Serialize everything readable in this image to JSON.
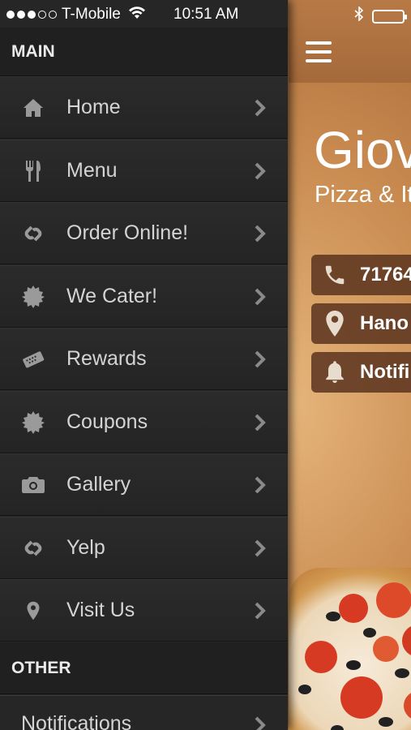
{
  "status_bar": {
    "carrier": "T-Mobile",
    "time": "10:51 AM"
  },
  "drawer": {
    "main_section": "MAIN",
    "main_items": [
      {
        "label": "Home",
        "icon": "home-icon"
      },
      {
        "label": "Menu",
        "icon": "fork-knife-icon"
      },
      {
        "label": "Order Online!",
        "icon": "link-icon"
      },
      {
        "label": "We Cater!",
        "icon": "seal-icon"
      },
      {
        "label": "Rewards",
        "icon": "ticket-icon"
      },
      {
        "label": "Coupons",
        "icon": "seal-icon"
      },
      {
        "label": "Gallery",
        "icon": "camera-icon"
      },
      {
        "label": "Yelp",
        "icon": "link-icon"
      },
      {
        "label": "Visit Us",
        "icon": "map-pin-icon"
      }
    ],
    "other_section": "OTHER",
    "other_items": [
      {
        "label": "Notifications"
      }
    ]
  },
  "main": {
    "title": "Giov",
    "subtitle": "Pizza & It",
    "buttons": [
      {
        "label": "71764",
        "icon": "phone-icon"
      },
      {
        "label": "Hano",
        "icon": "map-pin-icon"
      },
      {
        "label": "Notifi",
        "icon": "bell-icon"
      }
    ]
  },
  "colors": {
    "drawer_bg": "#262626",
    "accent_brown": "#a56a3a",
    "button_bg": "#5a341e"
  }
}
